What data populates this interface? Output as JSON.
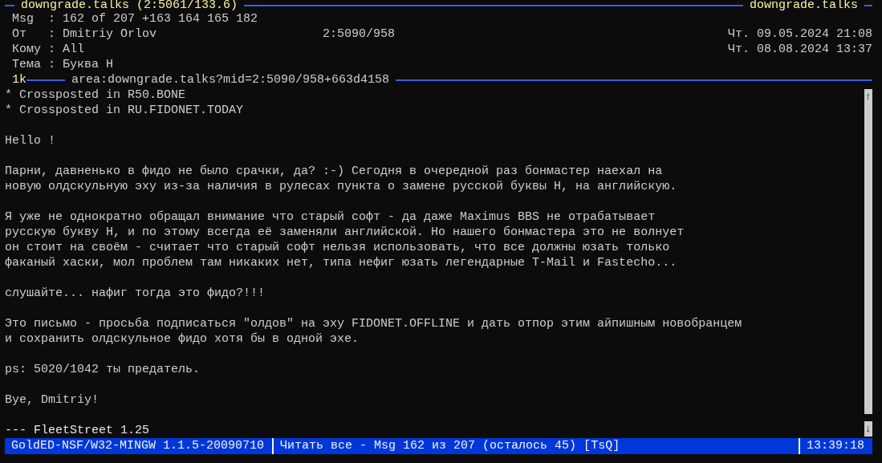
{
  "title_bar": {
    "area": "downgrade.talks (2:5061/133.6)",
    "area_short": "downgrade.talks"
  },
  "header": [
    {
      "label": "Msg  :",
      "value": "162 of 207 +163 164 165 182"
    },
    {
      "label": "От   :",
      "value": "Dmitriy Orlov",
      "address": "2:5090/958",
      "date": "Чт. 09.05.2024 21:08"
    },
    {
      "label": "Кому :",
      "value": "All",
      "date": "Чт. 08.08.2024 13:37"
    },
    {
      "label": "Тема :",
      "value": "Буква Н"
    }
  ],
  "divider": {
    "size": "1k",
    "link": "area:downgrade.talks?mid=2:5090/958+663d4158"
  },
  "body": {
    "paragraphs": [
      "* Crossposted in R50.BONE\n* Crossposted in RU.FIDONET.TODAY",
      "Hello !",
      "Парни, давненько в фидо не было срачки, да? :-) Сегодня в очередной раз бонмастер наехал на\nновую олдскульную эху из-за наличия в рулесах пункта о замене русской буквы Н, на английскую.",
      "Я уже не однократно обращал внимание что старый софт - да даже Maximus BBS не отрабатывает\nрусскую букву Н, и по этому всегда её заменяли английской. Но нашего бонмастера это не волнует\nон стоит на своём - считает что старый софт нельзя использовать, что все должны юзать только\nфаканый хаски, мол проблем там никаких нет, типа нефиг юзать легендарные T-Mail и Fastecho...",
      "слушайте... нафиг тогда это фидо?!!!",
      "Это письмо - просьба подписаться \"олдов\" на эху FIDONET.OFFLINE и дать отпор этим айпишным новобранцем\nи сохранить олдскульное фидо хотя бы в одной эхе.",
      "ps: 5020/1042 ты предатель.",
      "Bye, Dmitriy!"
    ],
    "tagline": "--- FleetStreet 1.25"
  },
  "scrollbar": {
    "up": "↑",
    "down": "↓"
  },
  "status_bar": [
    "GoldED-NSF/W32-MINGW 1.1.5-20090710",
    "Читать все - Msg 162 из 207 (осталось 45) [TsQ]",
    "13:39:18"
  ]
}
